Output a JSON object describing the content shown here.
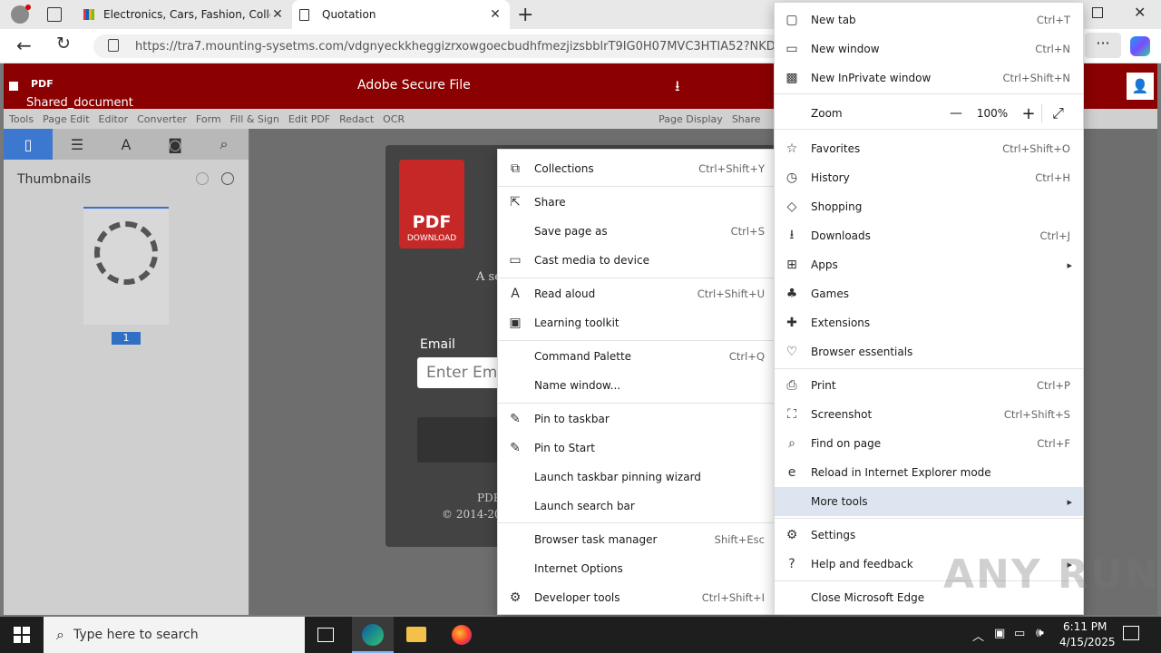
{
  "browser": {
    "tabs": [
      {
        "title": "Electronics, Cars, Fashion, Collecti"
      },
      {
        "title": "Quotation"
      }
    ],
    "url": "https://tra7.mounting-sysetms.com/vdgnyeckkheggizrxowgoecbudhfmezjizsbblrT9IG0H07MVC3HTIA52?NKDQUKD"
  },
  "page": {
    "header_title": "Adobe Secure File",
    "pdf_label": "PDF",
    "shared_document": "Shared_document",
    "toolbar_items": [
      "Tools",
      "Page Edit",
      "Editor",
      "Converter",
      "Form",
      "Fill & Sign",
      "Edit PDF",
      "Redact",
      "OCR"
    ],
    "toolbar_right": [
      "Page Display",
      "Share"
    ],
    "thumbnails_label": "Thumbnails",
    "page_number": "1",
    "dialog": {
      "icon_pdf": "PDF",
      "icon_download": "DOWNLOAD",
      "line_a": "A se",
      "email_label": "Email",
      "email_placeholder": "Enter Ema",
      "footer_1": "PDF",
      "footer_2": "© 2014-202"
    }
  },
  "more_tools_menu": [
    {
      "label": "Collections",
      "shortcut": "Ctrl+Shift+Y",
      "icon": "collections-icon"
    },
    {
      "label": "Share",
      "shortcut": "",
      "icon": "share-icon"
    },
    {
      "label": "Save page as",
      "shortcut": "Ctrl+S",
      "icon": ""
    },
    {
      "label": "Cast media to device",
      "shortcut": "",
      "icon": "cast-icon"
    },
    {
      "label": "Read aloud",
      "shortcut": "Ctrl+Shift+U",
      "icon": "read-aloud-icon"
    },
    {
      "label": "Learning toolkit",
      "shortcut": "",
      "icon": "learning-toolkit-icon"
    },
    {
      "label": "Command Palette",
      "shortcut": "Ctrl+Q",
      "icon": ""
    },
    {
      "label": "Name window...",
      "shortcut": "",
      "icon": ""
    },
    {
      "label": "Pin to taskbar",
      "shortcut": "",
      "icon": "pin-icon"
    },
    {
      "label": "Pin to Start",
      "shortcut": "",
      "icon": "pin-icon"
    },
    {
      "label": "Launch taskbar pinning wizard",
      "shortcut": "",
      "icon": ""
    },
    {
      "label": "Launch search bar",
      "shortcut": "",
      "icon": ""
    },
    {
      "label": "Browser task manager",
      "shortcut": "Shift+Esc",
      "icon": ""
    },
    {
      "label": "Internet Options",
      "shortcut": "",
      "icon": ""
    },
    {
      "label": "Developer tools",
      "shortcut": "Ctrl+Shift+I",
      "icon": "developer-tools-icon"
    }
  ],
  "main_menu": [
    {
      "label": "New tab",
      "shortcut": "Ctrl+T",
      "icon": "new-tab-icon"
    },
    {
      "label": "New window",
      "shortcut": "Ctrl+N",
      "icon": "new-window-icon"
    },
    {
      "label": "New InPrivate window",
      "shortcut": "Ctrl+Shift+N",
      "icon": "inprivate-icon"
    },
    {
      "label": "Zoom",
      "shortcut": "",
      "icon": ""
    },
    {
      "label": "Favorites",
      "shortcut": "Ctrl+Shift+O",
      "icon": "star-icon"
    },
    {
      "label": "History",
      "shortcut": "Ctrl+H",
      "icon": "history-icon"
    },
    {
      "label": "Shopping",
      "shortcut": "",
      "icon": "tag-icon"
    },
    {
      "label": "Downloads",
      "shortcut": "Ctrl+J",
      "icon": "download-icon"
    },
    {
      "label": "Apps",
      "shortcut": "",
      "icon": "apps-icon"
    },
    {
      "label": "Games",
      "shortcut": "",
      "icon": "games-icon"
    },
    {
      "label": "Extensions",
      "shortcut": "",
      "icon": "puzzle-icon"
    },
    {
      "label": "Browser essentials",
      "shortcut": "",
      "icon": "heart-icon"
    },
    {
      "label": "Print",
      "shortcut": "Ctrl+P",
      "icon": "print-icon"
    },
    {
      "label": "Screenshot",
      "shortcut": "Ctrl+Shift+S",
      "icon": "screenshot-icon"
    },
    {
      "label": "Find on page",
      "shortcut": "Ctrl+F",
      "icon": "find-icon"
    },
    {
      "label": "Reload in Internet Explorer mode",
      "shortcut": "",
      "icon": "ie-icon"
    },
    {
      "label": "More tools",
      "shortcut": "",
      "icon": ""
    },
    {
      "label": "Settings",
      "shortcut": "",
      "icon": "gear-icon"
    },
    {
      "label": "Help and feedback",
      "shortcut": "",
      "icon": "help-icon"
    },
    {
      "label": "Close Microsoft Edge",
      "shortcut": "",
      "icon": ""
    }
  ],
  "zoom": {
    "value": "100%",
    "minus": "—",
    "plus": "+"
  },
  "taskbar": {
    "search_placeholder": "Type here to search",
    "time": "6:11 PM",
    "date": "4/15/2025"
  },
  "watermark": "ANY RUN",
  "colors": {
    "brand_red": "#8b0000",
    "menu_highlight": "#dde6f0",
    "taskbar": "#1e1e1e"
  }
}
